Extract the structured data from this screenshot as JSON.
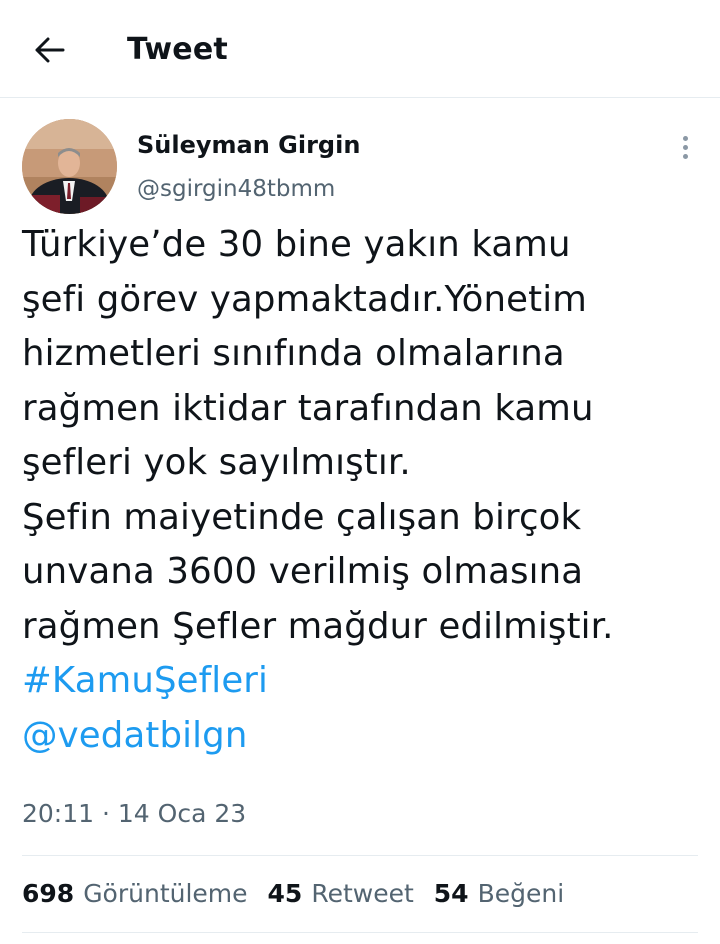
{
  "header": {
    "title": "Tweet",
    "back_icon": "arrow-left-icon"
  },
  "author": {
    "name": "Süleyman Girgin",
    "handle": "@sgirgin48tbmm",
    "avatar_icon": "profile-photo"
  },
  "tweet": {
    "lines": [
      "Türkiye’de 30 bine yakın kamu",
      "şefi görev yapmaktadır.Yönetim",
      "hizmetleri sınıfında olmalarına",
      "rağmen iktidar tarafından kamu",
      "şefleri yok sayılmıştır.",
      "Şefin maiyetinde çalışan birçok",
      "unvana 3600 verilmiş olmasına",
      "rağmen Şefler mağdur edilmiştir."
    ],
    "hashtag": "#KamuŞefleri",
    "mention": "@vedatbilgn",
    "timestamp": "20:11 · 14 Oca 23"
  },
  "stats": {
    "views_count": "698",
    "views_label": "Görüntüleme",
    "retweets_count": "45",
    "retweets_label": "Retweet",
    "likes_count": "54",
    "likes_label": "Beğeni"
  },
  "colors": {
    "link": "#1d9bf0",
    "secondary_text": "#536471",
    "divider": "#e6ecf0"
  }
}
